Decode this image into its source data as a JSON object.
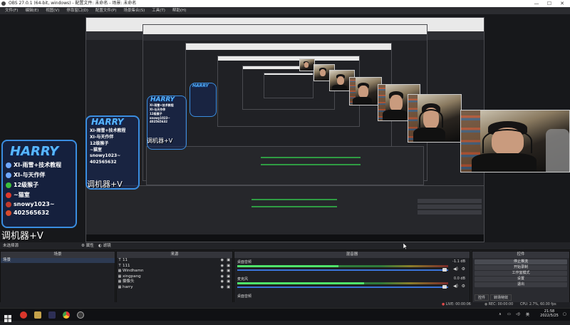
{
  "window": {
    "title": "OBS 27.0.1 (64-bit, windows) - 配置文件: 未命名 - 场景: 未命名",
    "min": "—",
    "max": "☐",
    "close": "✕"
  },
  "menu": [
    "文件(F)",
    "编辑(E)",
    "视图(V)",
    "停靠窗口(D)",
    "配置文件(P)",
    "场景集合(S)",
    "工具(T)",
    "帮助(H)"
  ],
  "overlay": {
    "title": "HARRY",
    "lines": [
      "XI-雨雪+技术教程",
      "XI-与天作伴",
      "12级猴子",
      "~猫室",
      "snowy1023~",
      "402565632"
    ],
    "caption": "调机器+V"
  },
  "context_bar": {
    "no_source": "未选择源",
    "properties": "属性",
    "filters": "滤镜"
  },
  "scenes": {
    "header": "场景",
    "items": [
      "场景"
    ],
    "tools": [
      "+",
      "−",
      "∧",
      "∨"
    ]
  },
  "sources": {
    "header": "来源",
    "items": [
      {
        "icon": "T",
        "name": "11"
      },
      {
        "icon": "T",
        "name": "111"
      },
      {
        "icon": "▦",
        "name": "Windhamn"
      },
      {
        "icon": "▦",
        "name": "xingpang"
      },
      {
        "icon": "▦",
        "name": "摄像头"
      },
      {
        "icon": "▦",
        "name": "harry"
      }
    ],
    "tools": [
      "+",
      "−",
      "⚙",
      "∧",
      "∨"
    ]
  },
  "mixer": {
    "header": "混音器",
    "channels": [
      {
        "name": "桌面音频",
        "db": "-1.1 dB",
        "level": 0.48
      },
      {
        "name": "麦克风",
        "db": "0.0 dB",
        "level": 0.6
      },
      {
        "name": "桌面音频",
        "db": "",
        "level": 0.0
      }
    ]
  },
  "controls": {
    "header": "控件",
    "buttons": [
      "停止推流",
      "开始录制",
      "工作室模式",
      "设置",
      "退出"
    ]
  },
  "tabs": [
    "控件",
    "转场特效"
  ],
  "status": {
    "live": "LIVE: 00:00:06",
    "rec": "REC: 00:00:00",
    "cpu": "CPU: 2.7%, 60.00 fps",
    "frames": "12大"
  },
  "taskbar": {
    "time": "21:58",
    "date": "2022/5/25",
    "apps": [
      "windows",
      "weibo",
      "app3",
      "app4",
      "chrome",
      "obs"
    ]
  },
  "colors": {
    "accent": "#3a73d8",
    "overlay_border": "#3a8de0",
    "meter_green": "#4fe36a"
  }
}
